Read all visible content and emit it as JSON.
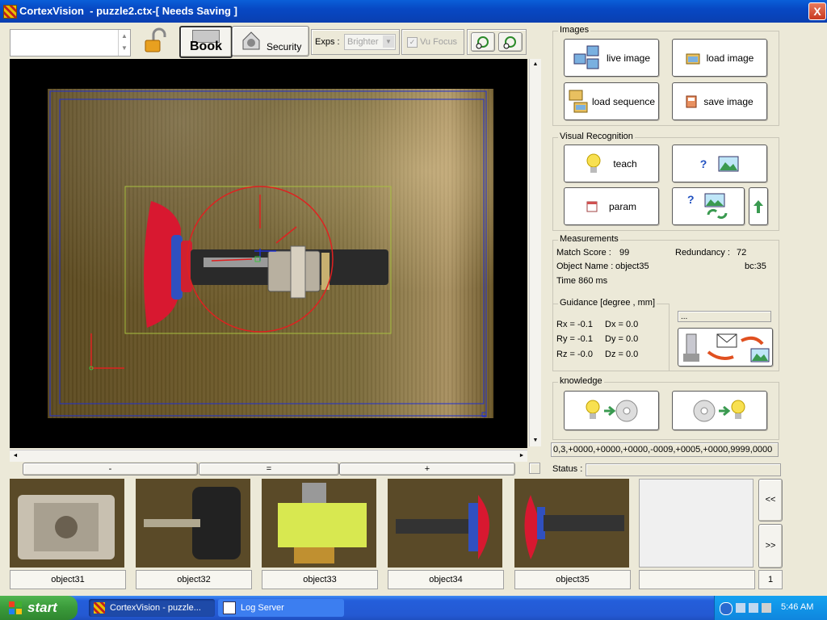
{
  "window": {
    "title": "CortexVision  - puzzle2.ctx-[ Needs Saving ]",
    "close_glyph": "X"
  },
  "toolbar": {
    "book_label": "Book",
    "security_label": "Security",
    "exps_label": "Exps :",
    "exps_value": "Brighter",
    "vufocus_label": "Vu Focus"
  },
  "scroll": {
    "left": "◄",
    "right": "►",
    "up": "▲",
    "down": "▼"
  },
  "zoom": {
    "minus": "-",
    "equal": "=",
    "plus": "+"
  },
  "images_panel": {
    "title": "Images",
    "live": "live image",
    "load": "load image",
    "load_seq": "load sequence",
    "save": "save image"
  },
  "visual_panel": {
    "title": "Visual Recognition",
    "teach": "teach",
    "param": "param"
  },
  "measurements": {
    "title": "Measurements",
    "match_label": "Match Score :",
    "match_value": "99",
    "redundancy_label": "Redundancy :",
    "redundancy_value": "72",
    "object_label": "Object Name :",
    "object_value": "object35",
    "bc_value": "bc:35",
    "time_value": "Time 860 ms"
  },
  "guidance": {
    "title": "Guidance [degree , mm]",
    "rx": "Rx = -0.1",
    "ry": "Ry = -0.1",
    "rz": "Rz = -0.0",
    "dx": "Dx = 0.0",
    "dy": "Dy = 0.0",
    "dz": "Dz = 0.0",
    "address": "..."
  },
  "knowledge": {
    "title": "knowledge"
  },
  "output_string": "0,3,+0000,+0000,+0000,-0009,+0005,+0000,9999,0000",
  "status_label": "Status :",
  "thumbnails": [
    "object31",
    "object32",
    "object33",
    "object34",
    "object35"
  ],
  "page_prev": "<<",
  "page_next": ">>",
  "page_number": "1",
  "taskbar": {
    "start": "start",
    "task1": "CortexVision  - puzzle...",
    "task2": "Log Server",
    "clock": "5:46 AM"
  },
  "colors": {
    "titlebar": "#0a48c4",
    "taskbar": "#245edb",
    "start": "#3a9a3a",
    "overlay_red": "#e02020",
    "overlay_blue": "#2030d0",
    "overlay_green": "#40c040"
  }
}
